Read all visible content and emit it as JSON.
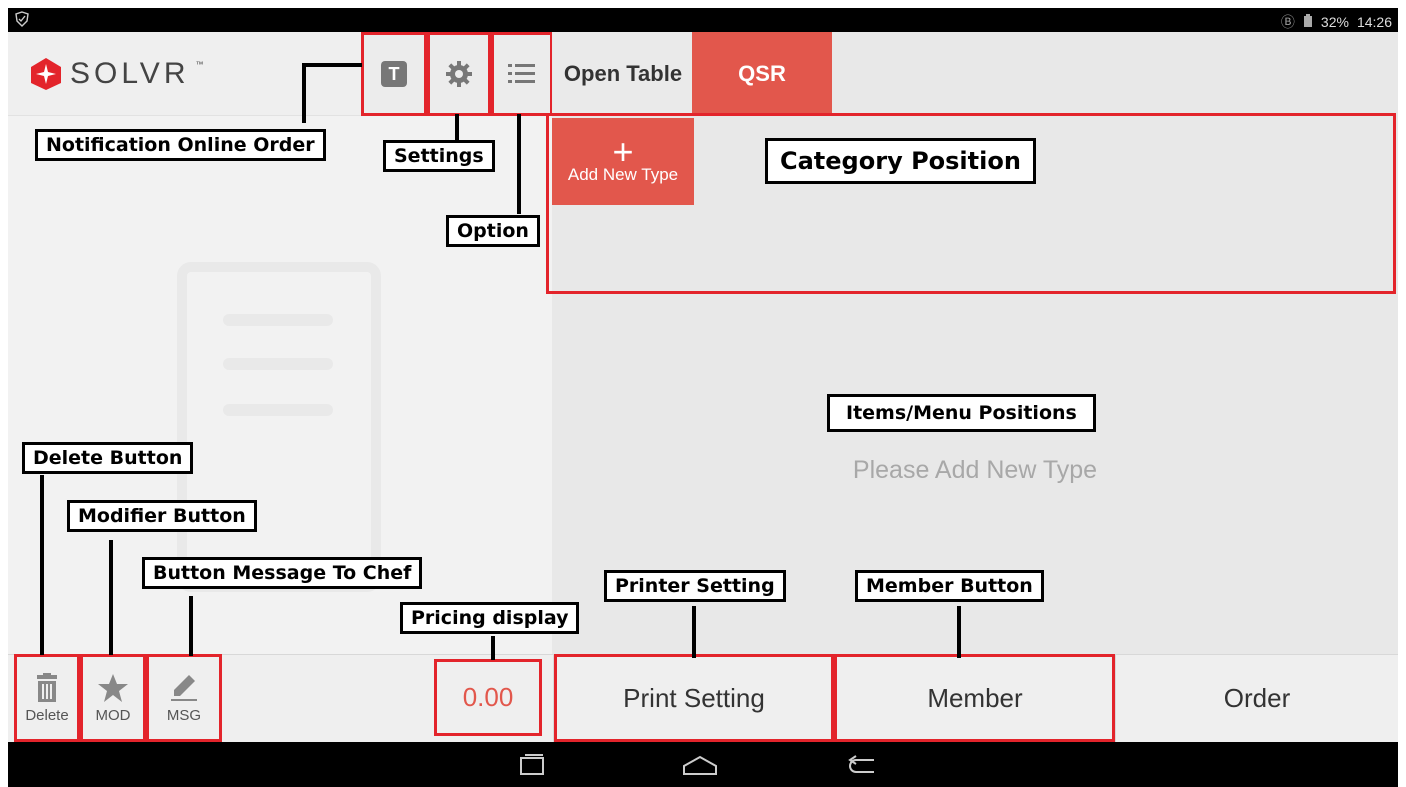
{
  "status": {
    "battery": "32%",
    "time": "14:26"
  },
  "brand": {
    "logo_text": "SOLVR",
    "logo_mark": "™"
  },
  "top": {
    "notif_letter": "T",
    "tabs": [
      {
        "label": "Open Table"
      },
      {
        "label": "QSR"
      }
    ]
  },
  "category": {
    "add_plus": "+",
    "add_label": "Add New Type"
  },
  "main": {
    "empty_message": "Please Add New Type"
  },
  "bottom": {
    "delete_label": "Delete",
    "mod_label": "MOD",
    "msg_label": "MSG",
    "price": "0.00",
    "print_label": "Print Setting",
    "member_label": "Member",
    "order_label": "Order"
  },
  "annotations": {
    "notification": "Notification Online Order",
    "settings": "Settings",
    "option": "Option",
    "category_position": "Category Position",
    "items_positions": "Items/Menu Positions",
    "delete_button": "Delete Button",
    "modifier_button": "Modifier Button",
    "message_chef": "Button Message To Chef",
    "pricing_display": "Pricing display",
    "printer_setting": "Printer Setting",
    "member_button": "Member Button"
  },
  "colors": {
    "accent": "#e2574c",
    "annotation_outline": "#e3242b"
  }
}
